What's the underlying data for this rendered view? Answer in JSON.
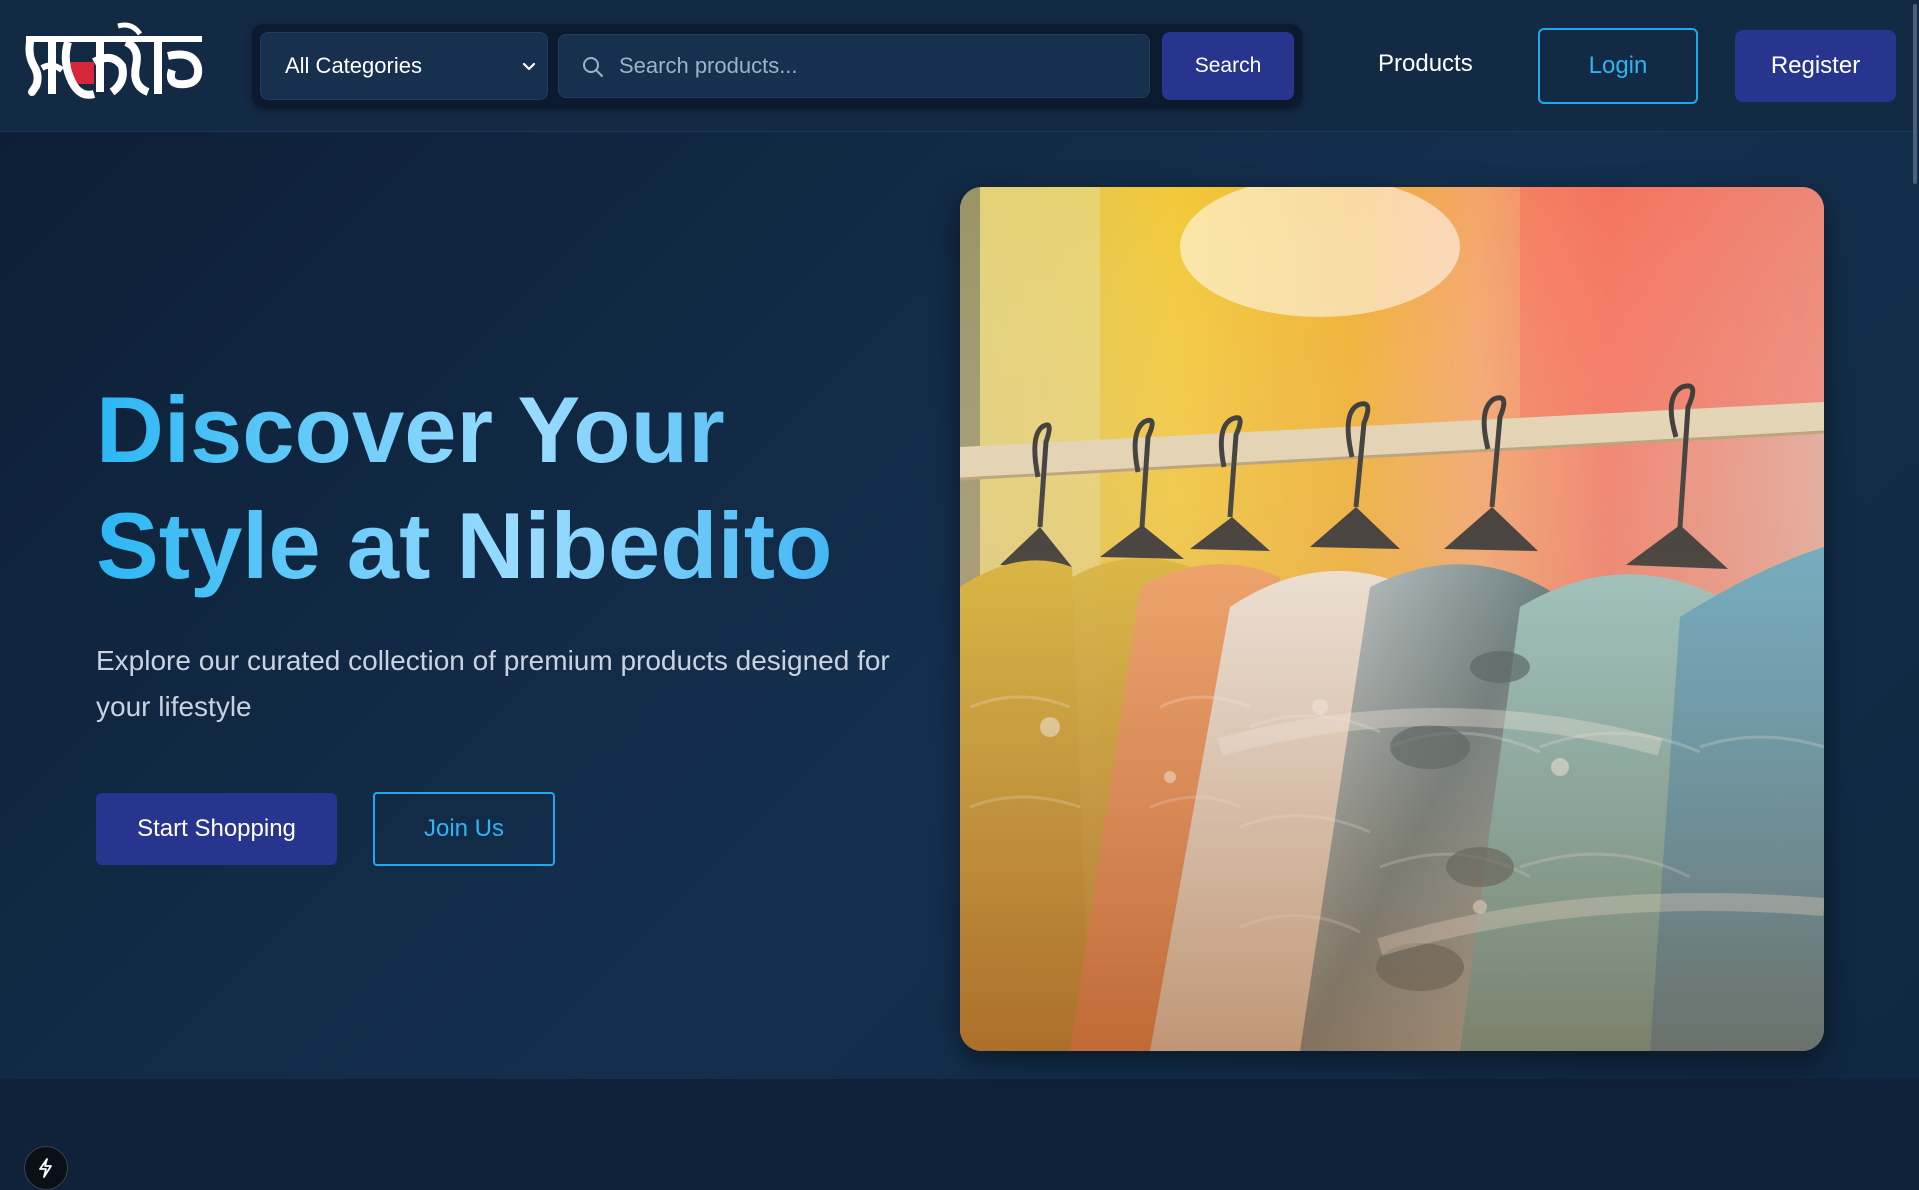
{
  "brand": {
    "logo_text": "নিবেদিত",
    "logo_name": "Nibedito"
  },
  "header": {
    "category_select": {
      "selected": "All Categories"
    },
    "search": {
      "placeholder": "Search products...",
      "value": "",
      "button_label": "Search"
    },
    "nav": {
      "products_label": "Products"
    },
    "login_label": "Login",
    "register_label": "Register"
  },
  "hero": {
    "title_line1": "Discover Your",
    "title_line2": "Style at Nibedito",
    "subtitle": "Explore our curated collection of premium products designed for your lifestyle",
    "primary_cta": "Start Shopping",
    "secondary_cta": "Join Us",
    "image": "clothing-rack-jackets"
  },
  "icons": {
    "search": "search-icon",
    "chevron": "chevron-down-icon",
    "devtools": "lightning-icon"
  },
  "colors": {
    "header_bg": "#132a45",
    "page_bg": "#0f2239",
    "primary_button": "#27358f",
    "accent": "#1ea8f0",
    "title_gradient_start": "#2cb7f3",
    "title_gradient_mid": "#9bdcff"
  }
}
